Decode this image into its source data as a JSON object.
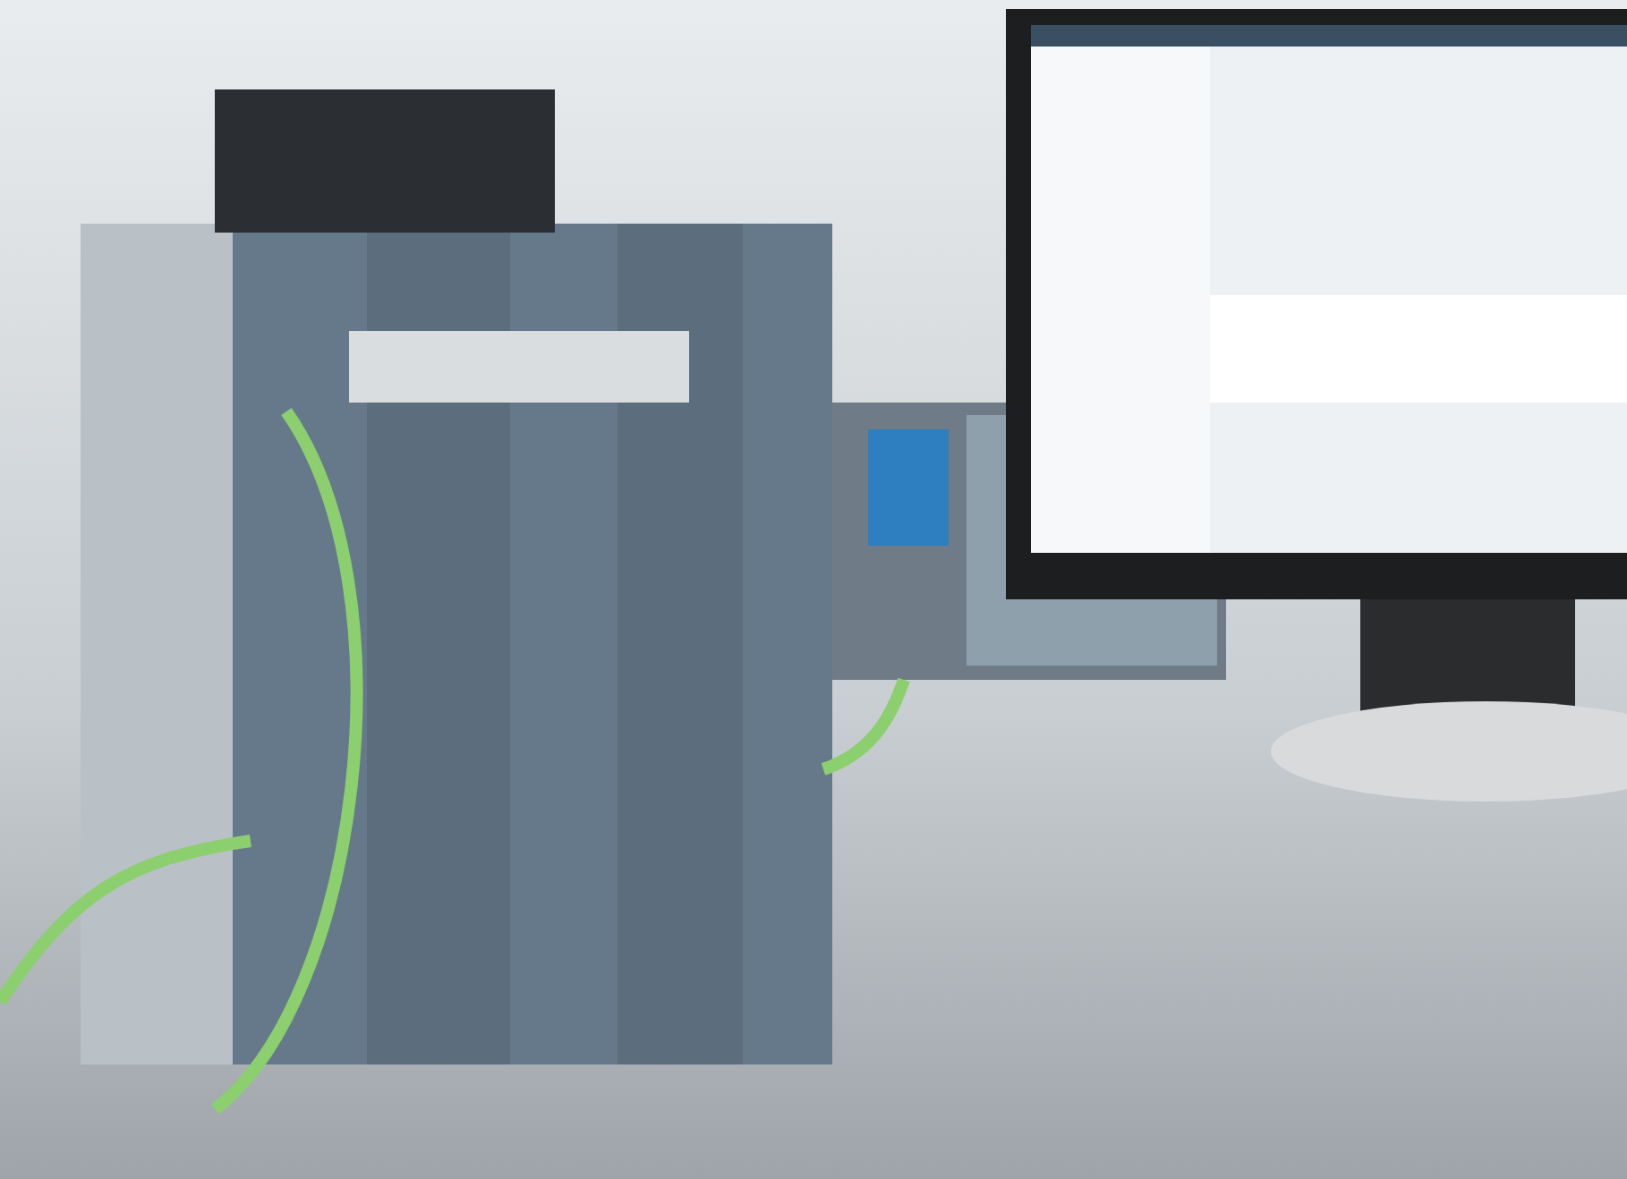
{
  "photo": {
    "kind": "product-scene"
  }
}
